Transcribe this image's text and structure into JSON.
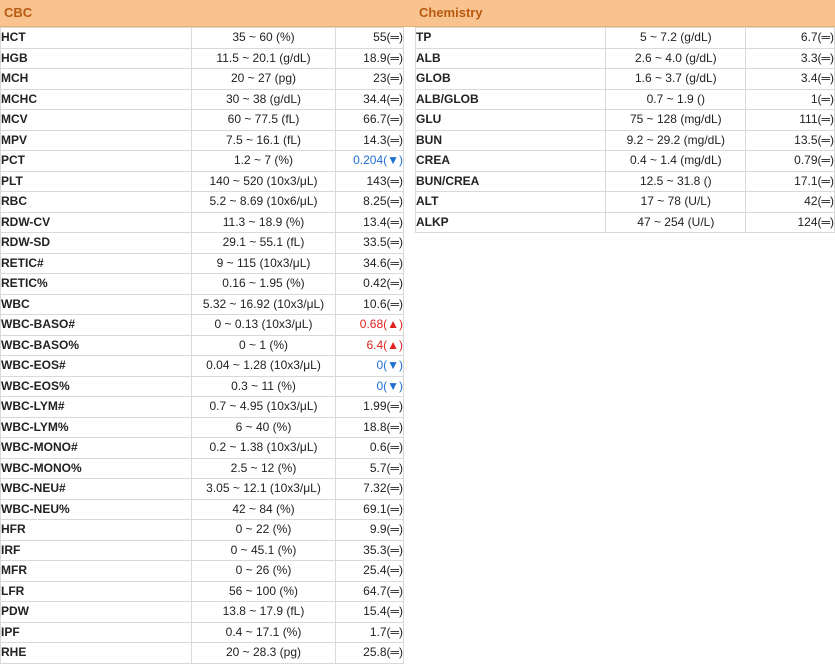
{
  "cbc": {
    "title": "CBC",
    "rows": [
      {
        "name": "HCT",
        "range": "35 ~ 60 (%)",
        "value": "55(═)",
        "flag": "normal"
      },
      {
        "name": "HGB",
        "range": "11.5 ~ 20.1 (g/dL)",
        "value": "18.9(═)",
        "flag": "normal"
      },
      {
        "name": "MCH",
        "range": "20 ~ 27 (pg)",
        "value": "23(═)",
        "flag": "normal"
      },
      {
        "name": "MCHC",
        "range": "30 ~ 38 (g/dL)",
        "value": "34.4(═)",
        "flag": "normal"
      },
      {
        "name": "MCV",
        "range": "60 ~ 77.5 (fL)",
        "value": "66.7(═)",
        "flag": "normal"
      },
      {
        "name": "MPV",
        "range": "7.5 ~ 16.1 (fL)",
        "value": "14.3(═)",
        "flag": "normal"
      },
      {
        "name": "PCT",
        "range": "1.2 ~ 7 (%)",
        "value": "0.204(▼)",
        "flag": "low"
      },
      {
        "name": "PLT",
        "range": "140 ~ 520 (10x3/μL)",
        "value": "143(═)",
        "flag": "normal"
      },
      {
        "name": "RBC",
        "range": "5.2 ~ 8.69 (10x6/μL)",
        "value": "8.25(═)",
        "flag": "normal"
      },
      {
        "name": "RDW-CV",
        "range": "11.3 ~ 18.9 (%)",
        "value": "13.4(═)",
        "flag": "normal"
      },
      {
        "name": "RDW-SD",
        "range": "29.1 ~ 55.1 (fL)",
        "value": "33.5(═)",
        "flag": "normal"
      },
      {
        "name": "RETIC#",
        "range": "9 ~ 115 (10x3/μL)",
        "value": "34.6(═)",
        "flag": "normal"
      },
      {
        "name": "RETIC%",
        "range": "0.16 ~ 1.95 (%)",
        "value": "0.42(═)",
        "flag": "normal"
      },
      {
        "name": "WBC",
        "range": "5.32 ~ 16.92 (10x3/μL)",
        "value": "10.6(═)",
        "flag": "normal"
      },
      {
        "name": "WBC-BASO#",
        "range": "0 ~ 0.13 (10x3/μL)",
        "value": "0.68(▲)",
        "flag": "high"
      },
      {
        "name": "WBC-BASO%",
        "range": "0 ~ 1 (%)",
        "value": "6.4(▲)",
        "flag": "high"
      },
      {
        "name": "WBC-EOS#",
        "range": "0.04 ~ 1.28 (10x3/μL)",
        "value": "0(▼)",
        "flag": "low"
      },
      {
        "name": "WBC-EOS%",
        "range": "0.3 ~ 11 (%)",
        "value": "0(▼)",
        "flag": "low"
      },
      {
        "name": "WBC-LYM#",
        "range": "0.7 ~ 4.95 (10x3/μL)",
        "value": "1.99(═)",
        "flag": "normal"
      },
      {
        "name": "WBC-LYM%",
        "range": "6 ~ 40 (%)",
        "value": "18.8(═)",
        "flag": "normal"
      },
      {
        "name": "WBC-MONO#",
        "range": "0.2 ~ 1.38 (10x3/μL)",
        "value": "0.6(═)",
        "flag": "normal"
      },
      {
        "name": "WBC-MONO%",
        "range": "2.5 ~ 12 (%)",
        "value": "5.7(═)",
        "flag": "normal"
      },
      {
        "name": "WBC-NEU#",
        "range": "3.05 ~ 12.1 (10x3/μL)",
        "value": "7.32(═)",
        "flag": "normal"
      },
      {
        "name": "WBC-NEU%",
        "range": "42 ~ 84 (%)",
        "value": "69.1(═)",
        "flag": "normal"
      },
      {
        "name": "HFR",
        "range": "0 ~ 22 (%)",
        "value": "9.9(═)",
        "flag": "normal"
      },
      {
        "name": "IRF",
        "range": "0 ~ 45.1 (%)",
        "value": "35.3(═)",
        "flag": "normal"
      },
      {
        "name": "MFR",
        "range": "0 ~ 26 (%)",
        "value": "25.4(═)",
        "flag": "normal"
      },
      {
        "name": "LFR",
        "range": "56 ~ 100 (%)",
        "value": "64.7(═)",
        "flag": "normal"
      },
      {
        "name": "PDW",
        "range": "13.8 ~ 17.9 (fL)",
        "value": "15.4(═)",
        "flag": "normal"
      },
      {
        "name": "IPF",
        "range": "0.4 ~ 17.1 (%)",
        "value": "1.7(═)",
        "flag": "normal"
      },
      {
        "name": "RHE",
        "range": "20 ~ 28.3 (pg)",
        "value": "25.8(═)",
        "flag": "normal"
      }
    ]
  },
  "chemistry": {
    "title": "Chemistry",
    "rows": [
      {
        "name": "TP",
        "range": "5 ~ 7.2 (g/dL)",
        "value": "6.7(═)",
        "flag": "normal"
      },
      {
        "name": "ALB",
        "range": "2.6 ~ 4.0 (g/dL)",
        "value": "3.3(═)",
        "flag": "normal"
      },
      {
        "name": "GLOB",
        "range": "1.6 ~ 3.7 (g/dL)",
        "value": "3.4(═)",
        "flag": "normal"
      },
      {
        "name": "ALB/GLOB",
        "range": "0.7 ~ 1.9 ()",
        "value": "1(═)",
        "flag": "normal"
      },
      {
        "name": "GLU",
        "range": "75 ~ 128 (mg/dL)",
        "value": "111(═)",
        "flag": "normal"
      },
      {
        "name": "BUN",
        "range": "9.2 ~ 29.2 (mg/dL)",
        "value": "13.5(═)",
        "flag": "normal"
      },
      {
        "name": "CREA",
        "range": "0.4 ~ 1.4 (mg/dL)",
        "value": "0.79(═)",
        "flag": "normal"
      },
      {
        "name": "BUN/CREA",
        "range": "12.5 ~ 31.8 ()",
        "value": "17.1(═)",
        "flag": "normal"
      },
      {
        "name": "ALT",
        "range": "17 ~ 78 (U/L)",
        "value": "42(═)",
        "flag": "normal"
      },
      {
        "name": "ALKP",
        "range": "47 ~ 254 (U/L)",
        "value": "124(═)",
        "flag": "normal"
      }
    ]
  }
}
